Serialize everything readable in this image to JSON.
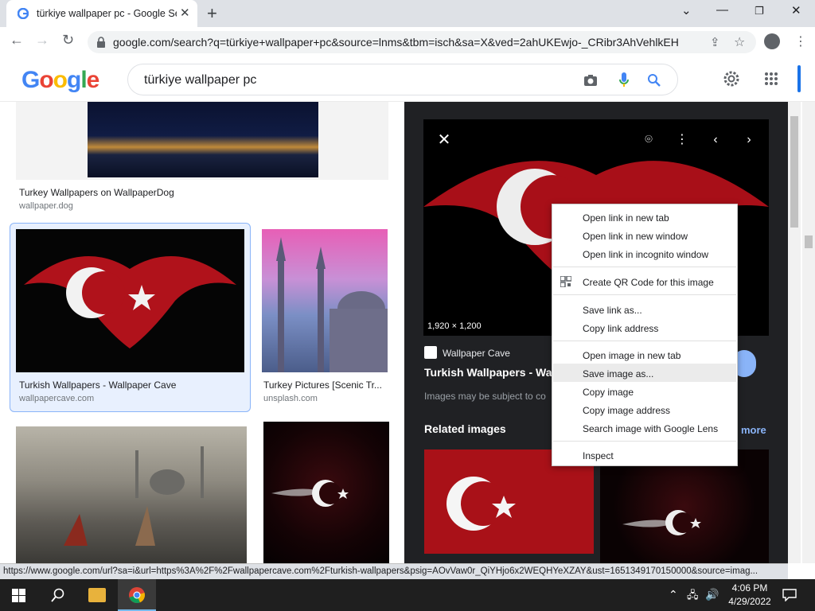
{
  "browser": {
    "tab_title": "türkiye wallpaper pc - Google Se",
    "tab_close": "✕",
    "new_tab": "+",
    "url": "google.com/search?q=türkiye+wallpaper+pc&source=lnms&tbm=isch&sa=X&ved=2ahUKEwjo-_CRibr3AhVehlkEHb...",
    "status_url": "https://www.google.com/url?sa=i&url=https%3A%2F%2Fwallpapercave.com%2Fturkish-wallpapers&psig=AOvVaw0r_QiYHjo6x2WEQHYeXZAY&ust=1651349170150000&source=imag..."
  },
  "google": {
    "query": "türkiye wallpaper pc"
  },
  "results": [
    {
      "caption": "Turkey Wallpapers on WallpaperDog",
      "source": "wallpaper.dog"
    },
    {
      "caption": "Turkish Wallpapers - Wallpaper Cave",
      "source": "wallpapercave.com"
    },
    {
      "caption": "Turkey Pictures [Scenic Tr...",
      "source": "unsplash.com"
    }
  ],
  "panel": {
    "dimensions": "1,920 × 1,200",
    "site": "Wallpaper Cave",
    "title": "Turkish Wallpapers - Wa",
    "notice": "Images may be subject to co",
    "related": "Related images",
    "more": "more"
  },
  "context_menu": {
    "items": [
      "Open link in new tab",
      "Open link in new window",
      "Open link in incognito window",
      "Create QR Code for this image",
      "Save link as...",
      "Copy link address",
      "Open image in new tab",
      "Save image as...",
      "Copy image",
      "Copy image address",
      "Search image with Google Lens",
      "Inspect"
    ]
  },
  "taskbar": {
    "time": "4:06 PM",
    "date": "4/29/2022"
  }
}
